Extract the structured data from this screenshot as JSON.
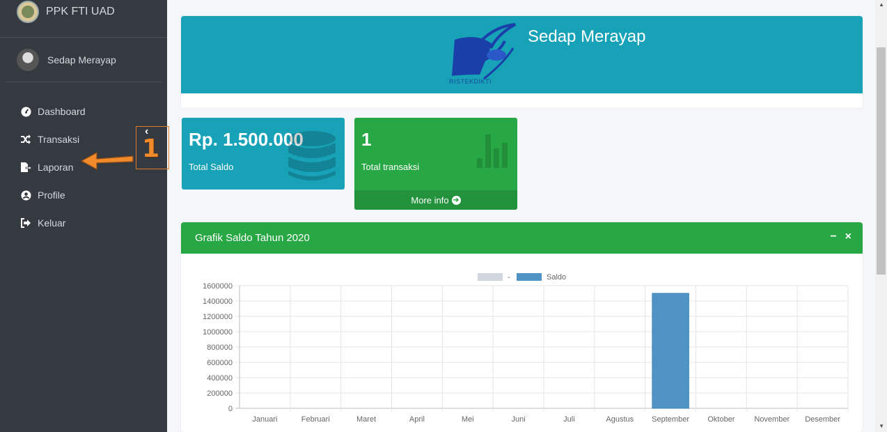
{
  "brand": {
    "name": "PPK FTI UAD"
  },
  "user": {
    "name": "Sedap Merayap"
  },
  "nav": [
    {
      "label": "Dashboard",
      "icon": "dashboard-icon"
    },
    {
      "label": "Transaksi",
      "icon": "shuffle-icon"
    },
    {
      "label": "Laporan",
      "icon": "file-export-icon"
    },
    {
      "label": "Profile",
      "icon": "user-circle-icon"
    },
    {
      "label": "Keluar",
      "icon": "sign-out-icon"
    }
  ],
  "annotation": {
    "number": "1",
    "color": "#f08a2a"
  },
  "header": {
    "title": "Sedap Merayap",
    "logo_caption": "RISTEKDIKTI"
  },
  "boxes": {
    "saldo": {
      "value": "Rp. 1.500.000",
      "label": "Total Saldo",
      "icon": "database-icon"
    },
    "transaksi": {
      "value": "1",
      "label": "Total transaksi",
      "icon": "bar-chart-icon",
      "more": "More info"
    }
  },
  "chart_card": {
    "title": "Grafik Saldo Tahun 2020",
    "minimize": "−",
    "close": "×"
  },
  "colors": {
    "sidebar": "#343a40",
    "info": "#17a2b8",
    "success": "#28a745",
    "bar": "#4f94c5"
  },
  "chart_data": {
    "type": "bar",
    "categories": [
      "Januari",
      "Februari",
      "Maret",
      "April",
      "Mei",
      "Juni",
      "Juli",
      "Agustus",
      "September",
      "Oktober",
      "November",
      "Desember"
    ],
    "series": [
      {
        "name": "-",
        "color": "#d2d6de",
        "values": [
          0,
          0,
          0,
          0,
          0,
          0,
          0,
          0,
          0,
          0,
          0,
          0
        ]
      },
      {
        "name": "Saldo",
        "color": "#4f94c5",
        "values": [
          0,
          0,
          0,
          0,
          0,
          0,
          0,
          0,
          1500000,
          0,
          0,
          0
        ]
      }
    ],
    "yticks": [
      "1600000",
      "1400000",
      "1200000",
      "1000000",
      "800000",
      "600000",
      "400000",
      "200000",
      "0"
    ],
    "ylim": [
      0,
      1600000
    ],
    "grid": true,
    "legend": "top-center"
  }
}
